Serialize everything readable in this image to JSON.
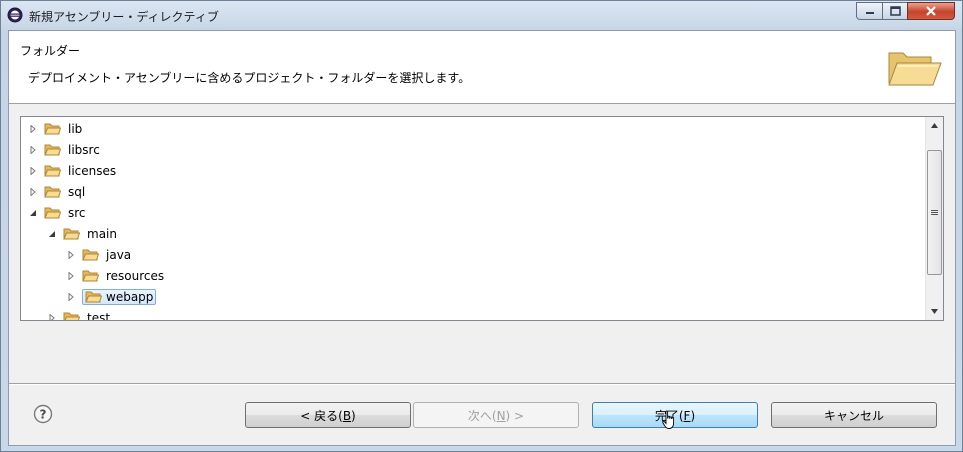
{
  "window": {
    "title": "新規アセンブリー・ディレクティブ"
  },
  "header": {
    "title": "フォルダー",
    "description": "デプロイメント・アセンブリーに含めるプロジェクト・フォルダーを選択します。",
    "icon": "folder-open-icon"
  },
  "tree": {
    "items": [
      {
        "label": "lib",
        "expanded": false
      },
      {
        "label": "libsrc",
        "expanded": false
      },
      {
        "label": "licenses",
        "expanded": false
      },
      {
        "label": "sql",
        "expanded": false
      },
      {
        "label": "src",
        "expanded": true
      },
      {
        "label": "main",
        "expanded": true
      },
      {
        "label": "java",
        "expanded": false
      },
      {
        "label": "resources",
        "expanded": false
      },
      {
        "label": "webapp",
        "expanded": false,
        "selected": true
      },
      {
        "label": "test",
        "expanded": false
      }
    ]
  },
  "buttons": {
    "back": {
      "prefix": "< 戻る(",
      "key": "B",
      "suffix": ")"
    },
    "next": {
      "prefix": "次へ(",
      "key": "N",
      "suffix": ") >"
    },
    "finish": {
      "prefix": "完了(",
      "key": "F",
      "suffix": ")"
    },
    "cancel": {
      "label": "キャンセル"
    }
  },
  "colors": {
    "selection_border": "#84acdd",
    "default_button": "#bee6fd",
    "close_button": "#c7432c"
  }
}
